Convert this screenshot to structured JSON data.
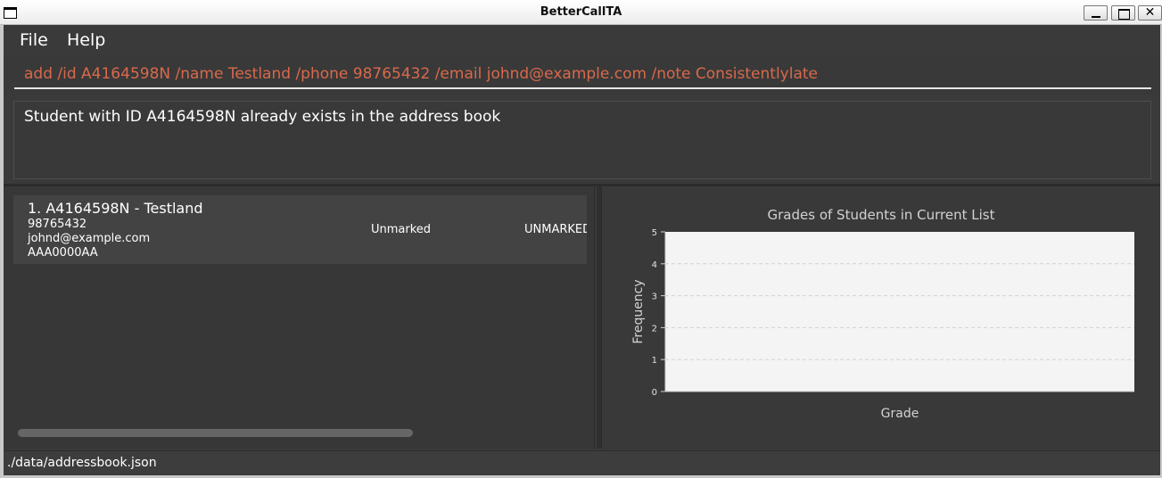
{
  "window": {
    "title": "BetterCallTA"
  },
  "menu": {
    "file": "File",
    "help": "Help"
  },
  "command_box": {
    "value": "add /id A4164598N /name Testland /phone 98765432 /email johnd@example.com /note Consistentlylate"
  },
  "result_display": {
    "text": "Student with ID A4164598N already exists in the address book"
  },
  "student_list": [
    {
      "title": "1.  A4164598N - Testland",
      "phone": "98765432",
      "email": "johnd@example.com",
      "room": "AAA0000AA",
      "attendance": "Unmarked",
      "status": "UNMARKED"
    }
  ],
  "status_bar": {
    "path": "./data/addressbook.json"
  },
  "colors": {
    "command_text": "#d9694b",
    "chart_plot_bg": "#f4f4f4"
  },
  "chart_data": {
    "type": "bar",
    "title": "Grades of Students in Current List",
    "xlabel": "Grade",
    "ylabel": "Frequency",
    "categories": [],
    "values": [],
    "ylim": [
      0,
      5
    ],
    "yticks": [
      0,
      1,
      2,
      3,
      4,
      5
    ],
    "grid": true,
    "legend": "none"
  }
}
